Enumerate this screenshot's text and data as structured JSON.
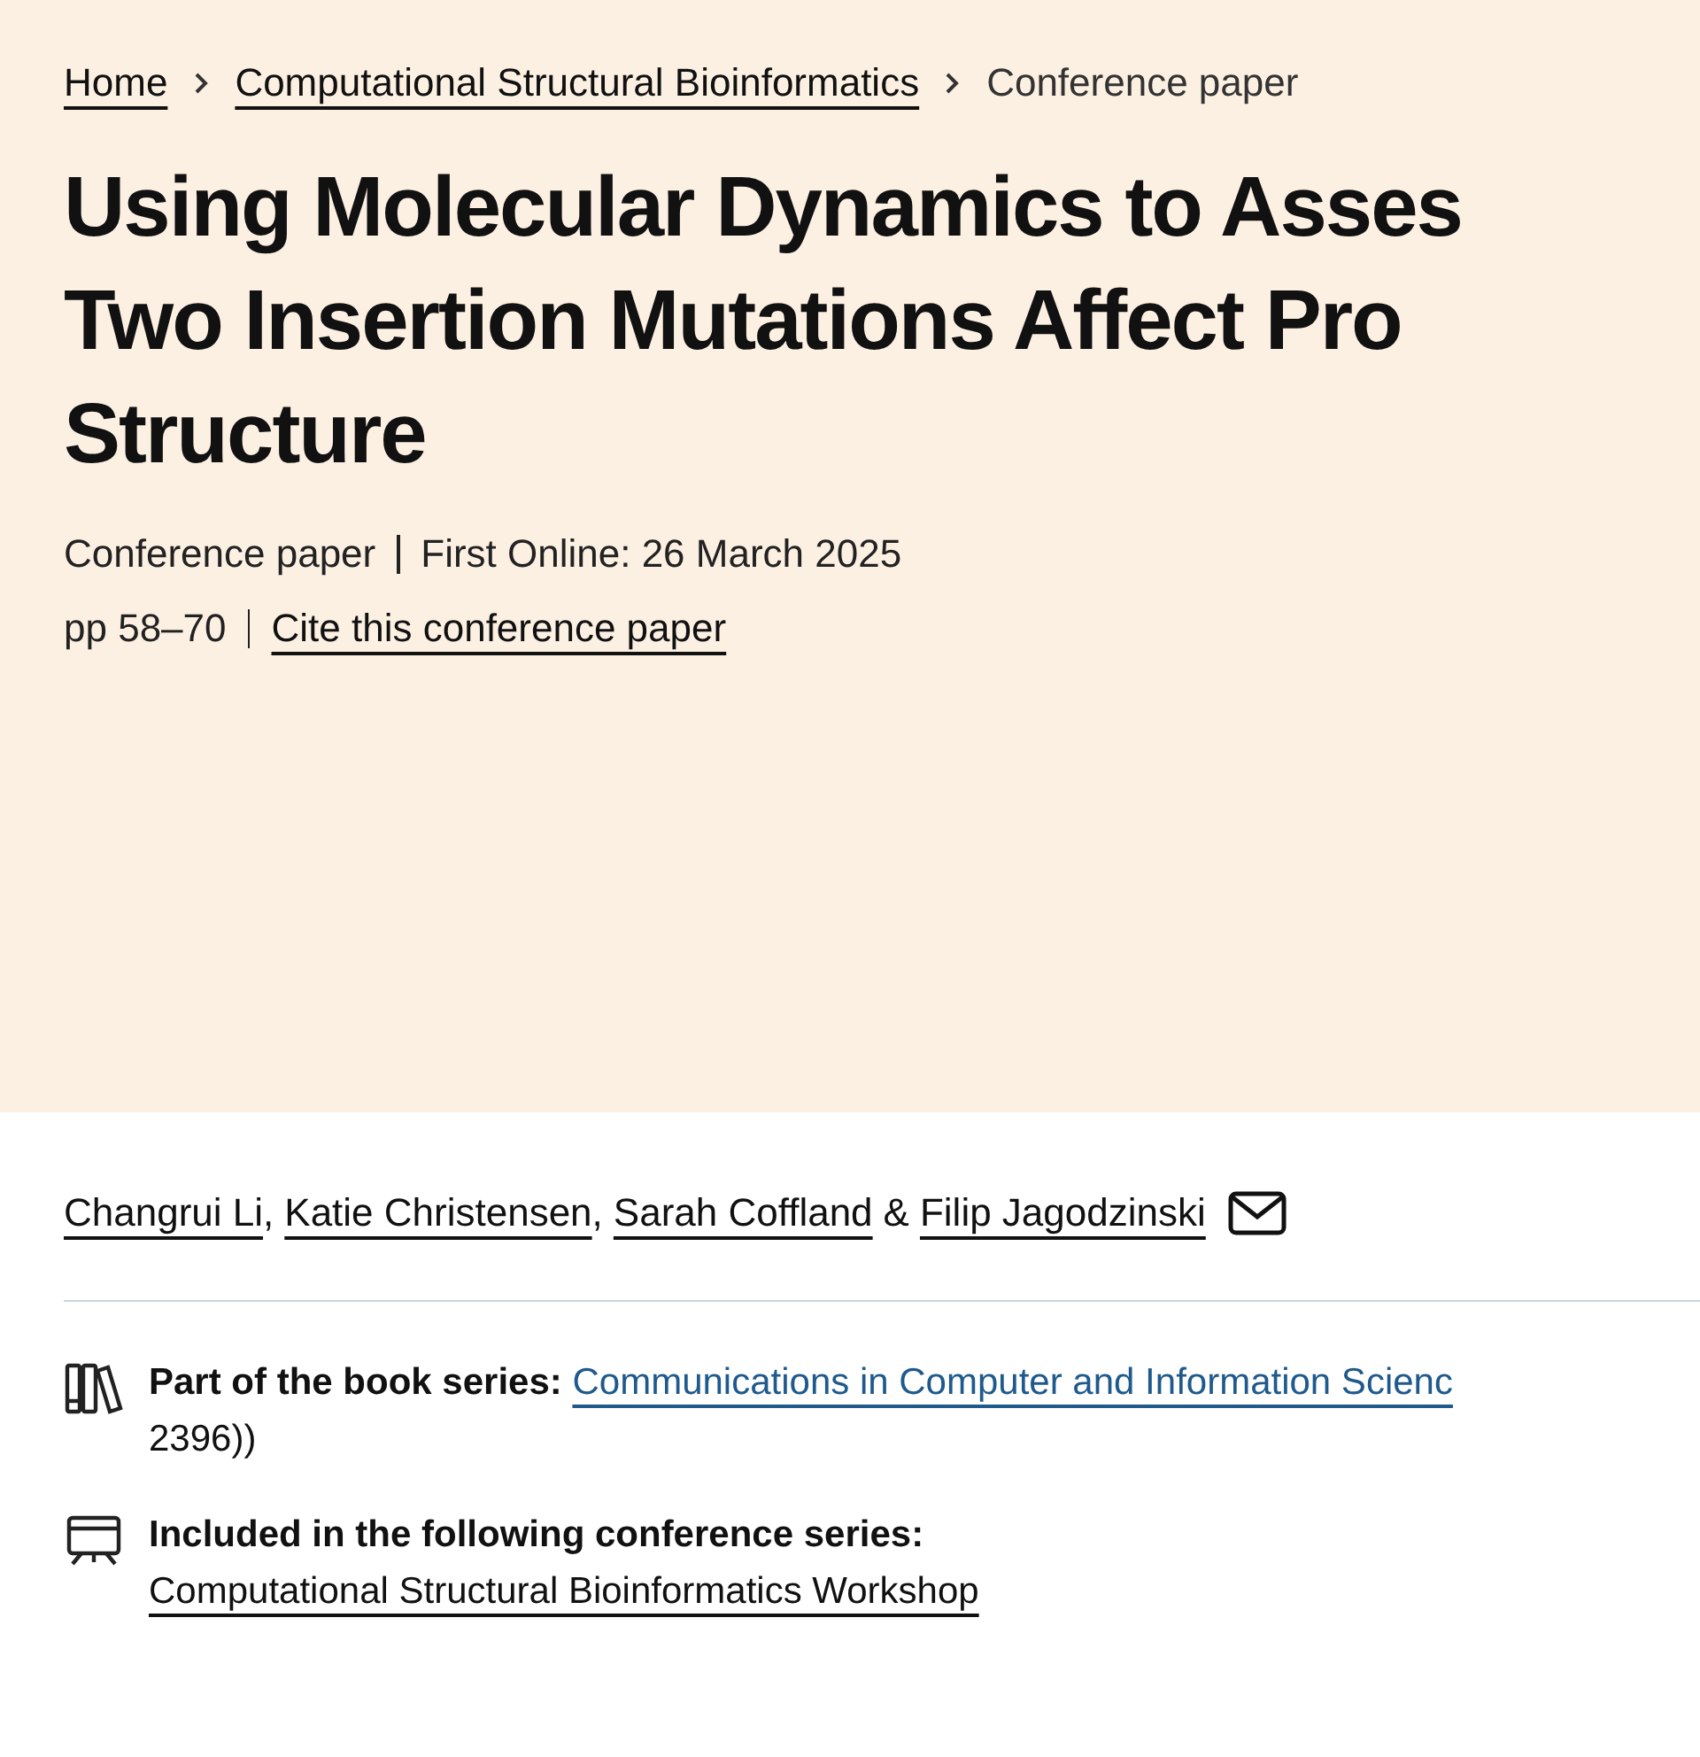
{
  "breadcrumbs": [
    {
      "label": "Home",
      "link": true
    },
    {
      "label": "Computational Structural Bioinformatics",
      "link": true
    },
    {
      "label": "Conference paper",
      "link": false
    }
  ],
  "title_lines": [
    "Using Molecular Dynamics to Asses",
    "Two Insertion Mutations Affect Pro",
    "Structure"
  ],
  "meta": {
    "type": "Conference paper",
    "first_online": "First Online: 26 March 2025",
    "pages": "pp 58–70",
    "cite": "Cite this conference paper"
  },
  "authors": [
    {
      "name": "Changrui Li",
      "sep": ","
    },
    {
      "name": "Katie Christensen",
      "sep": ","
    },
    {
      "name": "Sarah Coffland",
      "sep": "&"
    },
    {
      "name": "Filip Jagodzinski"
    }
  ],
  "book_series": {
    "label": "Part of the book series:",
    "link": "Communications in Computer and Information Scienc",
    "continuation": "2396))"
  },
  "conference_series": {
    "label": "Included in the following conference series:",
    "link": "Computational Structural Bioinformatics Workshop"
  }
}
